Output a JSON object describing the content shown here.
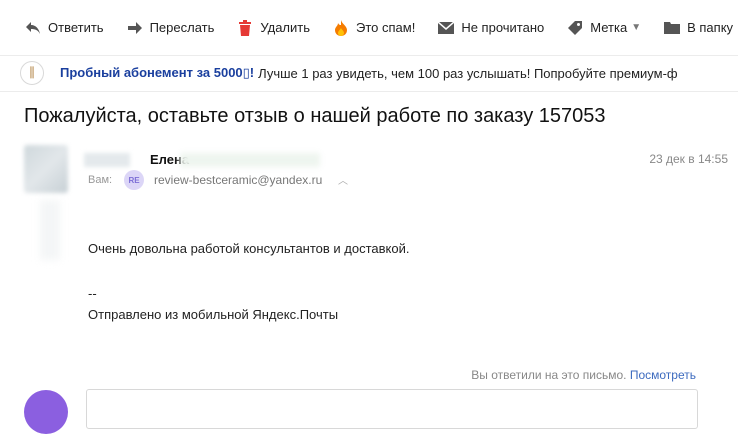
{
  "toolbar": {
    "reply": "Ответить",
    "forward": "Переслать",
    "delete": "Удалить",
    "spam": "Это спам!",
    "unread": "Не прочитано",
    "label": "Метка",
    "folder": "В папку"
  },
  "promo": {
    "logo": "∥",
    "bold": "Пробный абонемент за 5000▯!",
    "text": "Лучше 1 раз увидеть, чем 100 раз услышать! Попробуйте премиум-ф"
  },
  "email": {
    "subject": "Пожалуйста, оставьте отзыв о нашей работе по заказу 157053",
    "sender_name": "Елена",
    "date": "23 дек в 14:55",
    "to_label": "Вам:",
    "recipient_badge": "RE",
    "recipient_email": "review-bestceramic@yandex.ru",
    "body_line_1": "Очень довольна работой консультантов и доставкой.",
    "signature_dash": "--",
    "signature": "Отправлено из мобильной Яндекс.Почты"
  },
  "reply_info": {
    "text": "Вы ответили на это письмо.",
    "link": "Посмотреть"
  },
  "colors": {
    "promo_bold": "#1a3f9e",
    "link": "#3d6bbf",
    "delete_icon": "#e53935",
    "spam_icon": "#f57c00",
    "avatar_bottom": "#8b5fe0"
  }
}
